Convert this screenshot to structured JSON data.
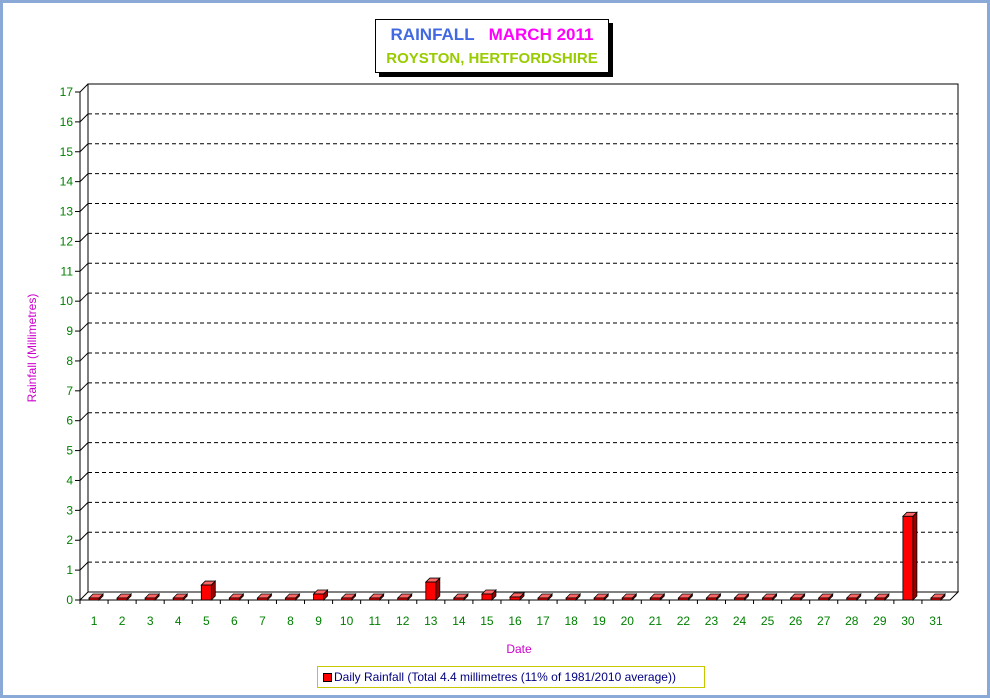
{
  "title": {
    "part1": "RAINFALL",
    "part2": "MARCH 2011",
    "subtitle": "ROYSTON, HERTFORDSHIRE"
  },
  "colors": {
    "title_blue": "#4169e1",
    "title_magenta": "#ff00ff",
    "subtitle_green": "#99cc00",
    "bar": "#ff0000",
    "axis_text": "#008000",
    "axis_label": "#cc00cc",
    "frame_border": "#8aa9d6"
  },
  "legend": {
    "label": "Daily Rainfall (Total 4.4 millimetres (11% of 1981/2010 average))"
  },
  "chart_data": {
    "type": "bar",
    "title": "RAINFALL MARCH 2011",
    "subtitle": "ROYSTON, HERTFORDSHIRE",
    "xlabel": "Date",
    "ylabel": "Rainfall  (Millimetres)",
    "ylim": [
      0,
      17
    ],
    "yticks": [
      0,
      1,
      2,
      3,
      4,
      5,
      6,
      7,
      8,
      9,
      10,
      11,
      12,
      13,
      14,
      15,
      16,
      17
    ],
    "grid": true,
    "legend_placement": "bottom",
    "categories": [
      "1",
      "2",
      "3",
      "4",
      "5",
      "6",
      "7",
      "8",
      "9",
      "10",
      "11",
      "12",
      "13",
      "14",
      "15",
      "16",
      "17",
      "18",
      "19",
      "20",
      "21",
      "22",
      "23",
      "24",
      "25",
      "26",
      "27",
      "28",
      "29",
      "30",
      "31"
    ],
    "series": [
      {
        "name": "Daily Rainfall (Total 4.4 millimetres (11% of 1981/2010 average))",
        "values": [
          0,
          0,
          0,
          0,
          0.5,
          0,
          0,
          0,
          0.2,
          0,
          0,
          0,
          0.6,
          0,
          0.2,
          0.1,
          0,
          0,
          0,
          0,
          0,
          0,
          0,
          0,
          0,
          0,
          0,
          0,
          0,
          2.8,
          0
        ]
      }
    ]
  }
}
